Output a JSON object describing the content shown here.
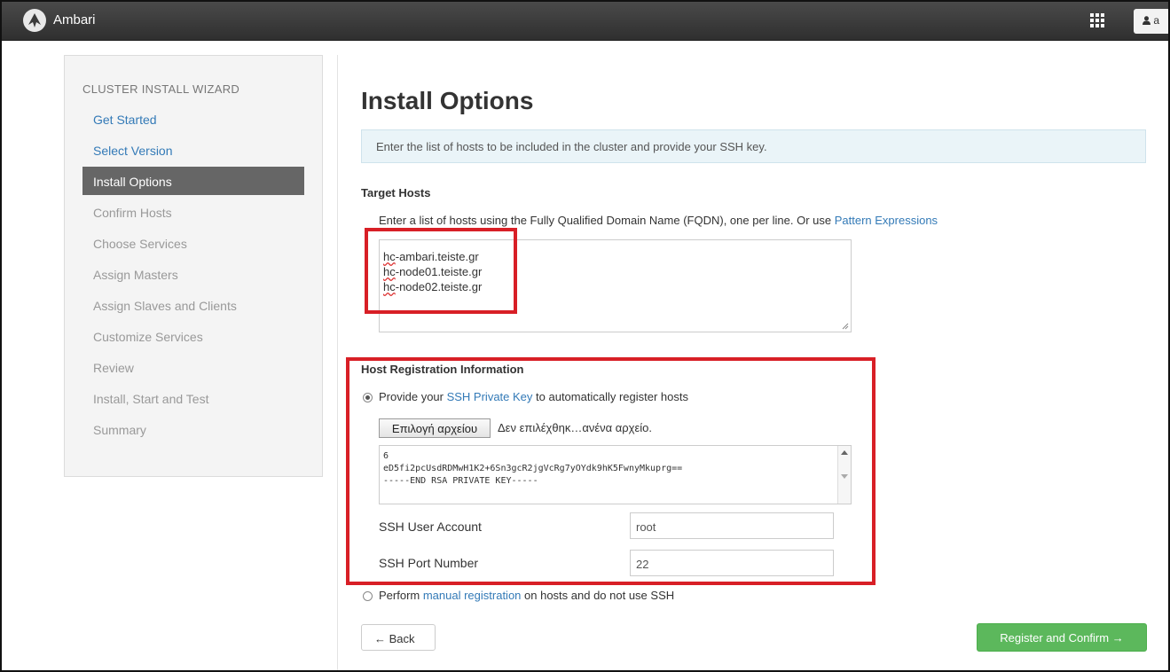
{
  "navbar": {
    "brand": "Ambari",
    "apps_icon": "grid-icon",
    "user_initial": "a"
  },
  "sidebar": {
    "title": "CLUSTER INSTALL WIZARD",
    "steps": [
      {
        "label": "Get Started",
        "state": "done"
      },
      {
        "label": "Select Version",
        "state": "done"
      },
      {
        "label": "Install Options",
        "state": "active"
      },
      {
        "label": "Confirm Hosts",
        "state": "todo"
      },
      {
        "label": "Choose Services",
        "state": "todo"
      },
      {
        "label": "Assign Masters",
        "state": "todo"
      },
      {
        "label": "Assign Slaves and Clients",
        "state": "todo"
      },
      {
        "label": "Customize Services",
        "state": "todo"
      },
      {
        "label": "Review",
        "state": "todo"
      },
      {
        "label": "Install, Start and Test",
        "state": "todo"
      },
      {
        "label": "Summary",
        "state": "todo"
      }
    ]
  },
  "main": {
    "title": "Install Options",
    "info": "Enter the list of hosts to be included in the cluster and provide your SSH key.",
    "target_hosts": {
      "heading": "Target Hosts",
      "help_prefix": "Enter a list of hosts using the Fully Qualified Domain Name (FQDN), one per line. Or use ",
      "help_link": "Pattern Expressions",
      "hosts": [
        {
          "prefix": "hc",
          "rest": "-ambari.teiste.gr"
        },
        {
          "prefix": "hc",
          "rest": "-node01.teiste.gr"
        },
        {
          "prefix": "hc",
          "rest": "-node02.teiste.gr"
        }
      ]
    },
    "host_registration": {
      "heading": "Host Registration Information",
      "ssh_option_prefix": "Provide your ",
      "ssh_option_link": "SSH Private Key",
      "ssh_option_suffix": " to automatically register hosts",
      "file_button": "Επιλογή αρχείου",
      "file_status": "Δεν επιλέχθηκ…ανένα αρχείο.",
      "key_lines": [
        "6",
        "eD5fi2pcUsdRDMwH1K2+6Sn3gcR2jgVcRg7yOYdk9hK5FwnyMkuprg==",
        "-----END RSA PRIVATE KEY-----"
      ],
      "ssh_user_label": "SSH User Account",
      "ssh_user_value": "root",
      "ssh_port_label": "SSH Port Number",
      "ssh_port_value": "22",
      "manual_prefix": "Perform ",
      "manual_link": "manual registration",
      "manual_suffix": " on hosts and do not use SSH",
      "ssh_selected": true
    },
    "back_button": "← Back",
    "register_button": "Register and Confirm →"
  },
  "colors": {
    "navbar": "#3a3a3a",
    "link": "#337ab7",
    "active_step": "#666666",
    "info_bg": "#eaf4f8",
    "register": "#5cb85c",
    "highlight": "#d81f26"
  }
}
